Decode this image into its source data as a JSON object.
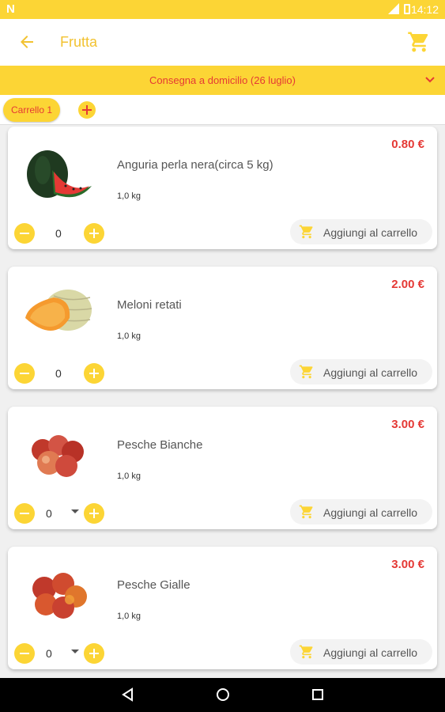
{
  "status_bar": {
    "time": "14:12",
    "left_icon": "N"
  },
  "app_bar": {
    "title": "Frutta"
  },
  "delivery": {
    "label": "Consegna a domicilio (26 luglio)"
  },
  "tabs": {
    "cart_tab": "Carrello 1"
  },
  "colors": {
    "accent": "#fcd535",
    "price": "#e53935",
    "title": "#f2c230"
  },
  "products": [
    {
      "name": "Anguria perla nera(circa 5 kg)",
      "weight": "1,0 kg",
      "price": "0.80 €",
      "qty": "0",
      "add_label": "Aggiungi al carrello",
      "image": "watermelon"
    },
    {
      "name": "Meloni retati",
      "weight": "1,0 kg",
      "price": "2.00 €",
      "qty": "0",
      "add_label": "Aggiungi al carrello",
      "image": "melon"
    },
    {
      "name": "Pesche Bianche",
      "weight": "1,0 kg",
      "price": "3.00 €",
      "qty": "0",
      "add_label": "Aggiungi al carrello",
      "image": "white-peaches"
    },
    {
      "name": "Pesche Gialle",
      "weight": "1,0 kg",
      "price": "3.00 €",
      "qty": "0",
      "add_label": "Aggiungi al carrello",
      "image": "yellow-peaches"
    }
  ]
}
